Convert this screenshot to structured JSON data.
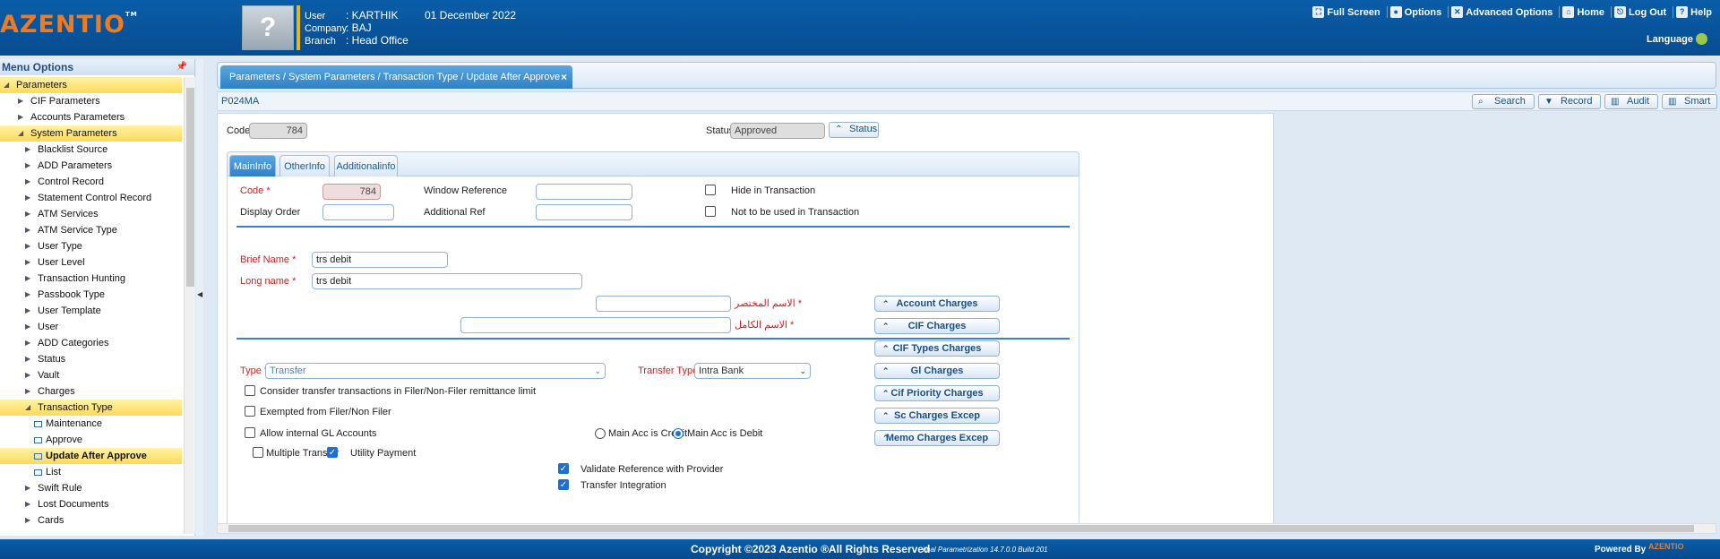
{
  "header": {
    "logo": "AZENTIO",
    "logo_tm": "TM",
    "user_label": "User",
    "user_value": ": KARTHIK",
    "company_label": "Company",
    "company_value": ": BAJ",
    "branch_label": "Branch",
    "branch_value": ": Head Office",
    "date": "01 December 2022",
    "menu": {
      "full_screen": "Full Screen",
      "options": "Options",
      "advanced_options": "Advanced Options",
      "home": "Home",
      "log_out": "Log Out",
      "help": "Help"
    },
    "language": "Language"
  },
  "sidebar": {
    "title": "Menu Options",
    "items": [
      {
        "label": "Parameters",
        "level": 0,
        "state": "open",
        "selected": true
      },
      {
        "label": "CIF Parameters",
        "level": 1,
        "state": "closed"
      },
      {
        "label": "Accounts Parameters",
        "level": 1,
        "state": "closed"
      },
      {
        "label": "System Parameters",
        "level": 1,
        "state": "open",
        "selected": true
      },
      {
        "label": "Blacklist Source",
        "level": 2,
        "state": "closed"
      },
      {
        "label": "ADD Parameters",
        "level": 2,
        "state": "closed"
      },
      {
        "label": "Control Record",
        "level": 2,
        "state": "closed"
      },
      {
        "label": "Statement Control Record",
        "level": 2,
        "state": "closed"
      },
      {
        "label": "ATM Services",
        "level": 2,
        "state": "closed"
      },
      {
        "label": "ATM Service Type",
        "level": 2,
        "state": "closed"
      },
      {
        "label": "User Type",
        "level": 2,
        "state": "closed"
      },
      {
        "label": "User Level",
        "level": 2,
        "state": "closed"
      },
      {
        "label": "Transaction Hunting",
        "level": 2,
        "state": "closed"
      },
      {
        "label": "Passbook Type",
        "level": 2,
        "state": "closed"
      },
      {
        "label": "User Template",
        "level": 2,
        "state": "closed"
      },
      {
        "label": "User",
        "level": 2,
        "state": "closed"
      },
      {
        "label": "ADD Categories",
        "level": 2,
        "state": "closed"
      },
      {
        "label": "Status",
        "level": 2,
        "state": "closed"
      },
      {
        "label": "Vault",
        "level": 2,
        "state": "closed"
      },
      {
        "label": "Charges",
        "level": 2,
        "state": "closed"
      },
      {
        "label": "Transaction Type",
        "level": 2,
        "state": "open",
        "selected": true
      },
      {
        "label": "Maintenance",
        "level": 3,
        "state": "page"
      },
      {
        "label": "Approve",
        "level": 3,
        "state": "page"
      },
      {
        "label": "Update After Approve",
        "level": 3,
        "state": "page",
        "selected": true,
        "bold": true
      },
      {
        "label": "List",
        "level": 3,
        "state": "page"
      },
      {
        "label": "Swift Rule",
        "level": 2,
        "state": "closed"
      },
      {
        "label": "Lost Documents",
        "level": 2,
        "state": "closed"
      },
      {
        "label": "Cards",
        "level": 2,
        "state": "closed"
      }
    ]
  },
  "tab": {
    "title": "Parameters / System Parameters / Transaction Type / Update After Approve",
    "close": "×"
  },
  "toolbar": {
    "screen_code": "P024MA",
    "search": "Search",
    "record": "Record",
    "audit": "Audit",
    "smart": "Smart"
  },
  "form": {
    "code_label": "Code",
    "code_value": "784",
    "status_label": "Status",
    "status_value": "Approved",
    "status_button": "Status",
    "tabs": {
      "main": "MainInfo",
      "other": "OtherInfo",
      "additional": "Additionalinfo"
    },
    "code2_label": "Code",
    "code2_value": "784",
    "display_order_label": "Display Order",
    "window_reference_label": "Window Reference",
    "additional_ref_label": "Additional Ref",
    "hide_in_transaction": "Hide in Transaction",
    "not_used_in_transaction": "Not to be used in Transaction",
    "brief_name_label": "Brief Name",
    "brief_name_value": "trs debit",
    "long_name_label": "Long name",
    "long_name_value": "trs debit",
    "arabic_brief_label": "الاسم المختصر",
    "arabic_long_label": "الاسم الكامل",
    "type_label": "Type",
    "type_value": "Transfer",
    "transfer_type_label": "Transfer Type",
    "transfer_type_value": "Intra Bank",
    "consider_filer": "Consider transfer transactions in Filer/Non-Filer remittance limit",
    "exempted_filer": "Exempted from Filer/Non Filer",
    "allow_gl": "Allow internal GL Accounts",
    "main_acc_credit": "Main Acc is Credit",
    "main_acc_debit": "Main Acc is Debit",
    "multiple_transfer": "Multiple Transfer",
    "utility_payment": "Utility Payment",
    "validate_reference": "Validate Reference with Provider",
    "transfer_integration": "Transfer Integration",
    "required_mark": "*"
  },
  "charges": {
    "account": "Account Charges",
    "cif": "CIF Charges",
    "cif_types": "CIF Types Charges",
    "gl": "Gl Charges",
    "cif_priority": "Cif Priority Charges",
    "sc_excep": "Sc Charges Excep",
    "memo_excep": "Memo Charges Excep"
  },
  "footer": {
    "copyright": "Copyright ©2023 Azentio ®All Rights Reserved",
    "build": "imal Parametrization 14.7.0.0 Build 201",
    "powered_by": "Powered By",
    "powered_logo": "AZENTIO"
  },
  "colors": {
    "header_blue": "#0a5da8",
    "brand_orange": "#f07a1e",
    "selected_yellow": "#ffd95a",
    "required_red": "#d0201f"
  }
}
